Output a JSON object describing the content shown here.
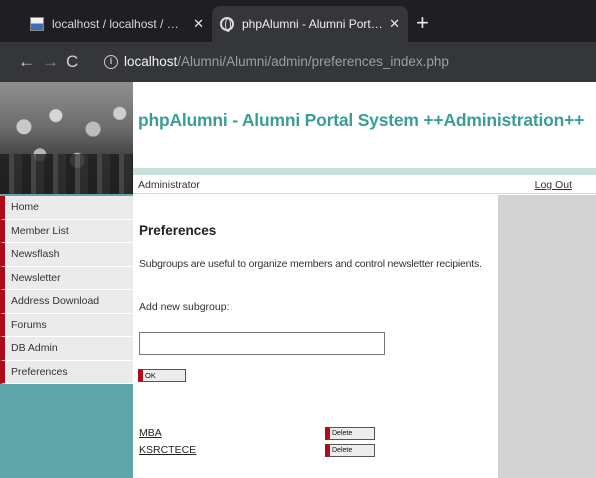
{
  "browser": {
    "tabs": [
      {
        "title": "localhost / localhost / mysql / us",
        "icon": "phpmyadmin-icon"
      },
      {
        "title": "phpAlumni - Alumni Portal Syste",
        "icon": "globe-icon"
      }
    ],
    "close_glyph": "✕",
    "new_tab_glyph": "+",
    "url_host": "localhost",
    "url_path": "/Alumni/Alumni/admin/preferences_index.php"
  },
  "header": {
    "site_title": "phpAlumni - Alumni Portal System ++Administration++",
    "user_label": "Administrator",
    "logout_label": "Log Out"
  },
  "sidebar": {
    "items": [
      {
        "label": "Home"
      },
      {
        "label": "Member List"
      },
      {
        "label": "Newsflash"
      },
      {
        "label": "Newsletter"
      },
      {
        "label": "Address Download"
      },
      {
        "label": "Forums"
      },
      {
        "label": "DB Admin"
      },
      {
        "label": "Preferences"
      }
    ]
  },
  "main": {
    "heading": "Preferences",
    "description": "Subgroups are useful to organize members and control newsletter recipients.",
    "add_label": "Add new subgroup:",
    "input_value": "",
    "ok_label": "OK",
    "subgroups": [
      {
        "name": "MBA",
        "delete_label": "Delete"
      },
      {
        "name": "KSRCTECE",
        "delete_label": "Delete"
      }
    ]
  },
  "colors": {
    "title_teal": "#3a9e94",
    "sidebar_teal": "#5fa6a8",
    "menu_accent_red": "#b00a1d",
    "right_column_gray": "#d3d3d3"
  }
}
